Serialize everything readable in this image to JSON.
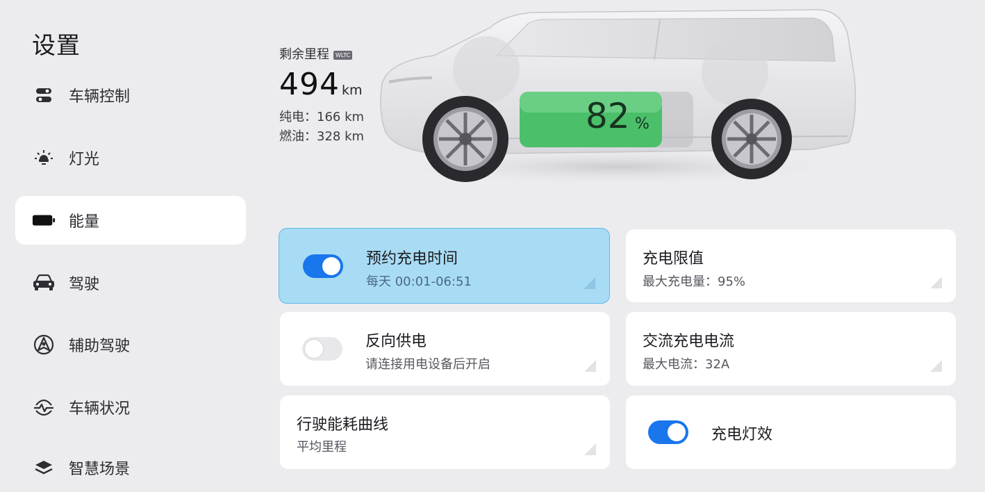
{
  "sidebar": {
    "title": "设置",
    "items": [
      {
        "label": "车辆控制",
        "icon": "vehicle-control-icon"
      },
      {
        "label": "灯光",
        "icon": "light-icon"
      },
      {
        "label": "能量",
        "icon": "battery-icon",
        "active": true
      },
      {
        "label": "驾驶",
        "icon": "car-icon"
      },
      {
        "label": "辅助驾驶",
        "icon": "assist-drive-icon"
      },
      {
        "label": "车辆状况",
        "icon": "vehicle-status-icon"
      },
      {
        "label": "智慧场景",
        "icon": "smart-scene-icon"
      }
    ]
  },
  "range": {
    "label": "剩余里程",
    "badge": "WLTC",
    "total": "494",
    "unit": "km",
    "electric": "纯电：166 km",
    "fuel": "燃油：328 km"
  },
  "battery": {
    "percent_value": 82,
    "percent": "82",
    "sign": "%"
  },
  "cards": {
    "scheduled_charge": {
      "title": "预约充电时间",
      "sub": "每天 00:01-06:51",
      "toggle": "on"
    },
    "charge_limit": {
      "title": "充电限值",
      "sub": "最大充电量：95%"
    },
    "reverse_power": {
      "title": "反向供电",
      "sub": "请连接用电设备后开启",
      "toggle": "off"
    },
    "ac_current": {
      "title": "交流充电电流",
      "sub": "最大电流：32A"
    },
    "energy_curve": {
      "title": "行驶能耗曲线",
      "sub": "平均里程"
    },
    "charge_light": {
      "title": "充电灯效",
      "toggle": "on"
    }
  },
  "colors": {
    "accent": "#1976ec",
    "highlight_card": "#a8dcf4",
    "battery_green": "#4bbf6a",
    "background": "#ececef"
  }
}
